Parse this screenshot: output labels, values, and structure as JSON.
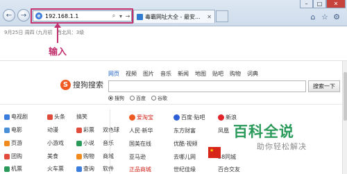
{
  "browser": {
    "url": "192.168.1.1",
    "tab_title": "毒霸网址大全 - 最安..."
  },
  "dateline": {
    "date": "9月25日 周四 (九月初",
    "weather": "西北风：3级"
  },
  "annotation": {
    "label": "输入",
    "color": "#c2306e"
  },
  "search": {
    "nav": [
      "网页",
      "视频",
      "图片",
      "音乐",
      "新闻",
      "地图",
      "贴吧",
      "购物",
      "词典"
    ],
    "logo_text": "搜狗搜索",
    "button": "搜索一下",
    "engines": [
      "搜狗",
      "百度",
      "谷歌"
    ]
  },
  "categories": [
    {
      "main": "电视剧",
      "subs": [
        "头条",
        "搞笑"
      ],
      "color": "#3b7ddd"
    },
    {
      "main": "电影",
      "subs": [
        "动漫",
        "彩票",
        "双色球"
      ],
      "color": "#4a90d9"
    },
    {
      "main": "页游",
      "subs": [
        "小游戏",
        "小说",
        "音乐"
      ],
      "color": "#f08a1c"
    },
    {
      "main": "团购",
      "subs": [
        "美食",
        "购物",
        "商城"
      ],
      "color": "#e04b3c"
    },
    {
      "main": "机票",
      "subs": [
        "火车票",
        "查询",
        "软件"
      ],
      "color": "#2a9a5a"
    }
  ],
  "sites": {
    "hot": [
      "爱淘宝",
      "百度·贴吧",
      "新浪"
    ],
    "row2": [
      "人民·新华",
      "东方财富",
      "凤凰"
    ],
    "row3": [
      "国美在线",
      "优酷·视频",
      ""
    ],
    "row4": [
      "亚马逊",
      "去哪儿网",
      "58同城"
    ],
    "row5": [
      "正品商城",
      "世纪佳缘",
      "百合交友"
    ]
  },
  "watermark": {
    "title": "百科全说",
    "subtitle": "助你轻松解决"
  }
}
